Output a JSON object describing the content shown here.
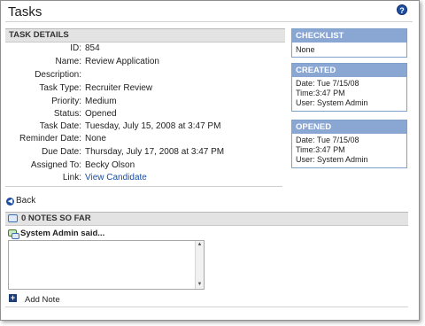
{
  "header": {
    "title": "Tasks",
    "help_icon": "?"
  },
  "task_details": {
    "heading": "TASK DETAILS",
    "rows": [
      {
        "label": "ID:",
        "value": "854"
      },
      {
        "label": "Name:",
        "value": "Review Application"
      },
      {
        "label": "Description:",
        "value": ""
      },
      {
        "label": "Task Type:",
        "value": "Recruiter Review"
      },
      {
        "label": "Priority:",
        "value": "Medium"
      },
      {
        "label": "Status:",
        "value": "Opened"
      },
      {
        "label": "Task Date:",
        "value": "Tuesday, July 15, 2008 at 3:47 PM"
      },
      {
        "label": "Reminder Date:",
        "value": "None"
      },
      {
        "label": "Due Date:",
        "value": "Thursday, July 17, 2008 at 3:47 PM"
      },
      {
        "label": "Assigned To:",
        "value": "Becky Olson"
      },
      {
        "label": "Link:",
        "value": "View Candidate"
      }
    ]
  },
  "checklist": {
    "heading": "CHECKLIST",
    "value": "None"
  },
  "created": {
    "heading": "CREATED",
    "date": "Date: Tue 7/15/08",
    "time": "Time:3:47 PM",
    "user": "User: System Admin"
  },
  "opened": {
    "heading": "OPENED",
    "date": "Date: Tue 7/15/08",
    "time": "Time:3:47 PM",
    "user": "User: System Admin"
  },
  "back": {
    "label": "Back"
  },
  "notes": {
    "heading": "0 NOTES SO FAR",
    "said": "System Admin said...",
    "textarea_value": "",
    "add_label": "Add Note"
  },
  "colors": {
    "accent": "#8aa7d4",
    "link": "#1a4fa3",
    "section_bg": "#e3e3e3"
  },
  "icons": {
    "help": "help-icon",
    "back": "back-arrow-icon",
    "notes": "speech-bubbles-icon",
    "said": "chat-icon",
    "add": "add-icon"
  }
}
